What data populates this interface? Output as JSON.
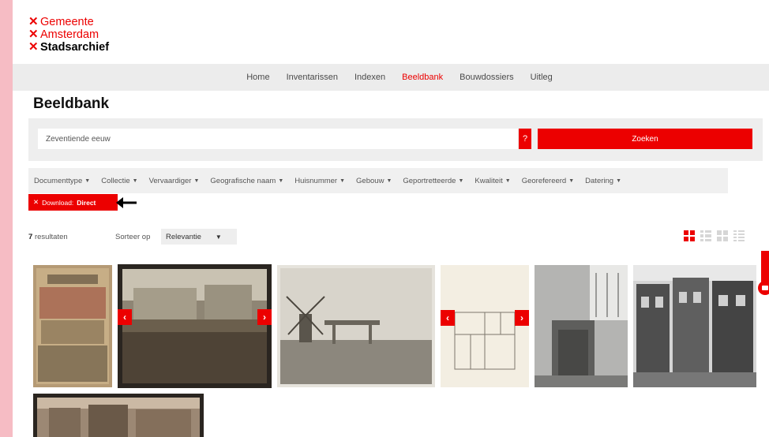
{
  "logo": {
    "lines": [
      "Gemeente",
      "Amsterdam",
      "Stadsarchief"
    ],
    "mark": "✕"
  },
  "nav": {
    "items": [
      "Home",
      "Inventarissen",
      "Indexen",
      "Beeldbank",
      "Bouwdossiers",
      "Uitleg"
    ],
    "active": "Beeldbank"
  },
  "page_title": "Beeldbank",
  "search": {
    "value": "Zeventiende eeuw",
    "help_label": "?",
    "button_label": "Zoeken"
  },
  "filters": [
    "Documenttype",
    "Collectie",
    "Vervaardiger",
    "Geografische naam",
    "Huisnummer",
    "Gebouw",
    "Geportretteerde",
    "Kwaliteit",
    "Georefereerd",
    "Datering"
  ],
  "active_filter": {
    "remove_icon": "✕",
    "label": "Download:",
    "value": "Direct"
  },
  "results": {
    "count": "7",
    "label": "resultaten",
    "sort_label": "Sorteer op",
    "sort_value": "Relevantie"
  },
  "gallery": {
    "prev_label": "‹",
    "next_label": "›",
    "items": [
      {
        "name": "thumb-handeling-poster",
        "bg": "#b59a75",
        "dark": false
      },
      {
        "name": "thumb-crowd-photo",
        "bg": "#8e8574",
        "dark": true
      },
      {
        "name": "thumb-windmill-print",
        "bg": "#d8d4cb",
        "dark": false
      },
      {
        "name": "thumb-floor-plan",
        "bg": "#f3eee2",
        "dark": false
      },
      {
        "name": "thumb-church-interior",
        "bg": "#9a9a98",
        "dark": false
      },
      {
        "name": "thumb-canal-houses",
        "bg": "#5d5d5d",
        "dark": false
      },
      {
        "name": "thumb-street-photo",
        "bg": "#9c8874",
        "dark": true
      }
    ]
  },
  "colors": {
    "accent": "#ec0000",
    "frame": "#f6bcc4"
  }
}
